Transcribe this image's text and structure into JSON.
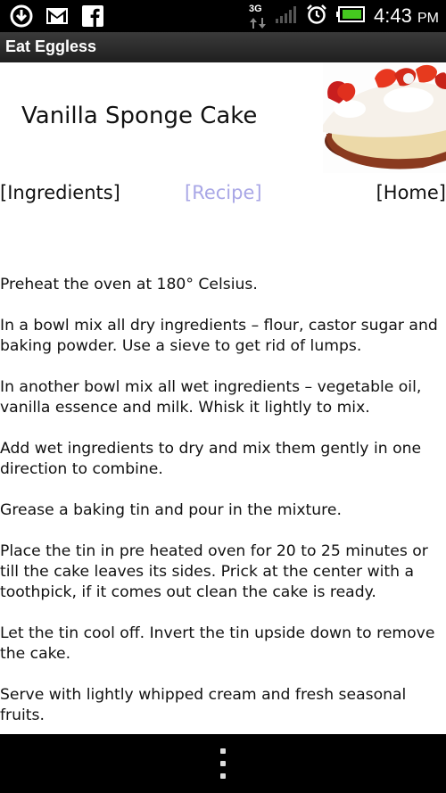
{
  "status_bar": {
    "network_type": "3G",
    "time": "4:43",
    "time_suffix": "PM"
  },
  "app": {
    "title": "Eat Eggless"
  },
  "recipe": {
    "title": "Vanilla Sponge Cake"
  },
  "nav": {
    "ingredients": "[Ingredients]",
    "recipe": "[Recipe]",
    "home": "[Home]",
    "active_color": "#a9a7e6"
  },
  "steps": [
    "Preheat the oven at 180° Celsius.",
    "In a bowl mix all dry ingredients – flour, castor sugar and baking powder. Use a sieve to get rid of lumps.",
    "In another bowl mix all wet ingredients – vegetable oil, vanilla essence and milk. Whisk it lightly to mix.",
    "Add wet ingredients to dry and mix them gently in one direction to combine.",
    "Grease a baking tin and pour in the mixture.",
    "Place the tin in pre heated oven for 20 to 25 minutes or till the cake leaves its sides. Prick at the center with a toothpick, if it comes out clean the cake is ready.",
    "Let the tin cool off. Invert the tin upside down to remove the cake.",
    "Serve with lightly whipped cream and fresh seasonal fruits."
  ],
  "icons": {
    "download": "download-icon",
    "gmail": "gmail-icon",
    "facebook": "facebook-icon",
    "signal": "signal-icon",
    "alarm": "alarm-icon",
    "battery": "battery-icon",
    "menu": "overflow-menu-icon"
  }
}
